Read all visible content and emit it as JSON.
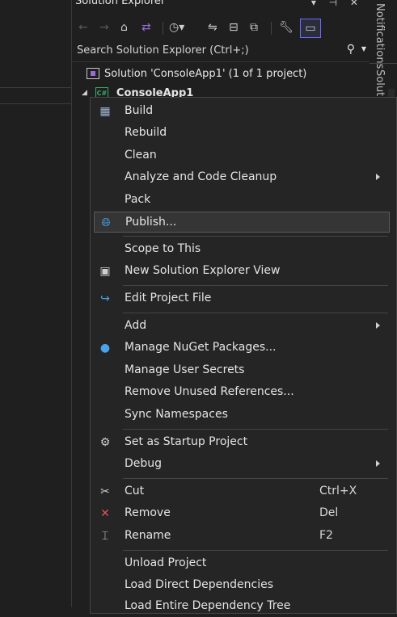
{
  "explorer": {
    "title": "Solution Explorer",
    "title_buttons": "▾ ⊣ ✕",
    "search_placeholder": "Search Solution Explorer (Ctrl+;)",
    "solution_label": "Solution 'ConsoleApp1' (1 of 1 project)",
    "project_label": "ConsoleApp1",
    "project_icon_text": "C#"
  },
  "side_tabs": {
    "notifications": "Notifications",
    "solution": "Solution"
  },
  "menu": {
    "build": "Build",
    "rebuild": "Rebuild",
    "clean": "Clean",
    "analyze": "Analyze and Code Cleanup",
    "pack": "Pack",
    "publish": "Publish...",
    "scope": "Scope to This",
    "new_view": "New Solution Explorer View",
    "edit_project": "Edit Project File",
    "add": "Add",
    "nuget": "Manage NuGet Packages...",
    "secrets": "Manage User Secrets",
    "remove_refs": "Remove Unused References...",
    "sync_ns": "Sync Namespaces",
    "startup": "Set as Startup Project",
    "debug": "Debug",
    "cut": "Cut",
    "cut_key": "Ctrl+X",
    "remove": "Remove",
    "remove_key": "Del",
    "rename": "Rename",
    "rename_key": "F2",
    "unload": "Unload Project",
    "load_direct": "Load Direct Dependencies",
    "load_tree": "Load Entire Dependency Tree"
  },
  "colors": {
    "accent": "#6b6bff",
    "highlight": "#353535",
    "menu_bg": "#252526",
    "remove_icon": "#e05555"
  }
}
